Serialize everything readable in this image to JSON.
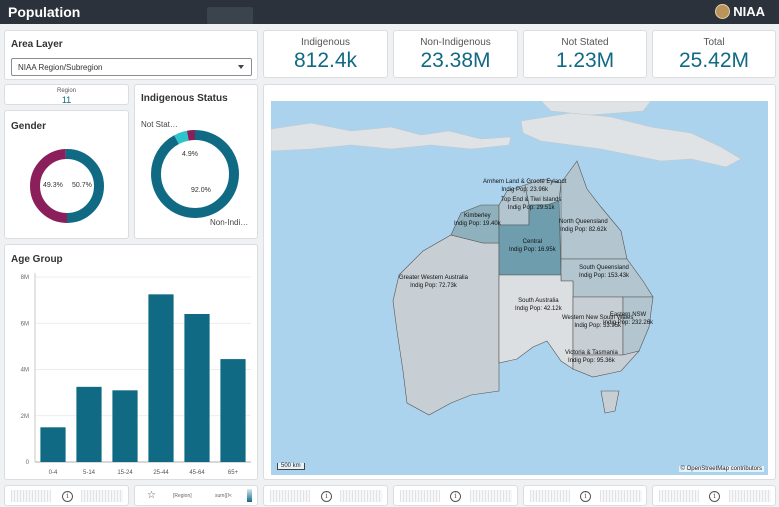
{
  "app": {
    "title": "Population",
    "logo_text": "NIAA"
  },
  "area_layer": {
    "title": "Area Layer",
    "selected": "NIAA Region/Subregion"
  },
  "kpis": [
    {
      "label": "Indigenous",
      "value": "812.4k"
    },
    {
      "label": "Non-Indigenous",
      "value": "23.38M"
    },
    {
      "label": "Not Stated",
      "value": "1.23M"
    },
    {
      "label": "Total",
      "value": "25.42M"
    }
  ],
  "region_count": {
    "label": "Region",
    "value": "11"
  },
  "gender": {
    "title": "Gender",
    "slices": [
      {
        "pct": 49.3,
        "label": "49.3%",
        "color": "#8b1f5b"
      },
      {
        "pct": 50.7,
        "label": "50.7%",
        "color": "#116a83"
      }
    ]
  },
  "indigenous_status": {
    "title": "Indigenous Status",
    "slices": [
      {
        "pct": 92.0,
        "label": "92.0%",
        "color": "#116a83"
      },
      {
        "pct": 4.9,
        "label": "4.9%",
        "color": "#2ec4cc"
      },
      {
        "pct": 3.1,
        "label": "",
        "color": "#8b1f5b"
      }
    ],
    "legend_top": "Not Stat…",
    "legend_bottom": "Non-Indi…"
  },
  "chart_data": {
    "type": "bar",
    "title": "Age Group",
    "categories": [
      "0-4",
      "5-14",
      "15-24",
      "25-44",
      "45-64",
      "65+"
    ],
    "values": [
      1.5,
      3.25,
      3.1,
      7.25,
      6.4,
      4.45
    ],
    "value_unit": "M",
    "yticks": [
      "0",
      "2M",
      "4M",
      "6M",
      "8M"
    ],
    "ylim": [
      0,
      8
    ],
    "color": "#116a83"
  },
  "map": {
    "scale": "500 km",
    "attribution": "© OpenStreetMap contributors",
    "regions": [
      {
        "name": "Arnhem Land & Groote Eylandt",
        "pop": "Indig Pop: 23.96k"
      },
      {
        "name": "Top End & Tiwi Islands",
        "pop": "Indig Pop: 29.51k"
      },
      {
        "name": "Kimberley",
        "pop": "Indig Pop: 19.40k"
      },
      {
        "name": "Central",
        "pop": "Indig Pop: 16.95k"
      },
      {
        "name": "North Queensland",
        "pop": "Indig Pop: 82.62k"
      },
      {
        "name": "Greater Western Australia",
        "pop": "Indig Pop: 72.73k"
      },
      {
        "name": "South Queensland",
        "pop": "Indig Pop: 153.43k"
      },
      {
        "name": "South Australia",
        "pop": "Indig Pop: 42.12k"
      },
      {
        "name": "Eastern NSW",
        "pop": "Indig Pop: 232.26k"
      },
      {
        "name": "Western New South Wales",
        "pop": "Indig Pop: 53.95k"
      },
      {
        "name": "Victoria & Tasmania",
        "pop": "Indig Pop: 95.36k"
      }
    ]
  },
  "footer": {
    "field_label": "[Region]",
    "measure_label": "sum([I<"
  }
}
